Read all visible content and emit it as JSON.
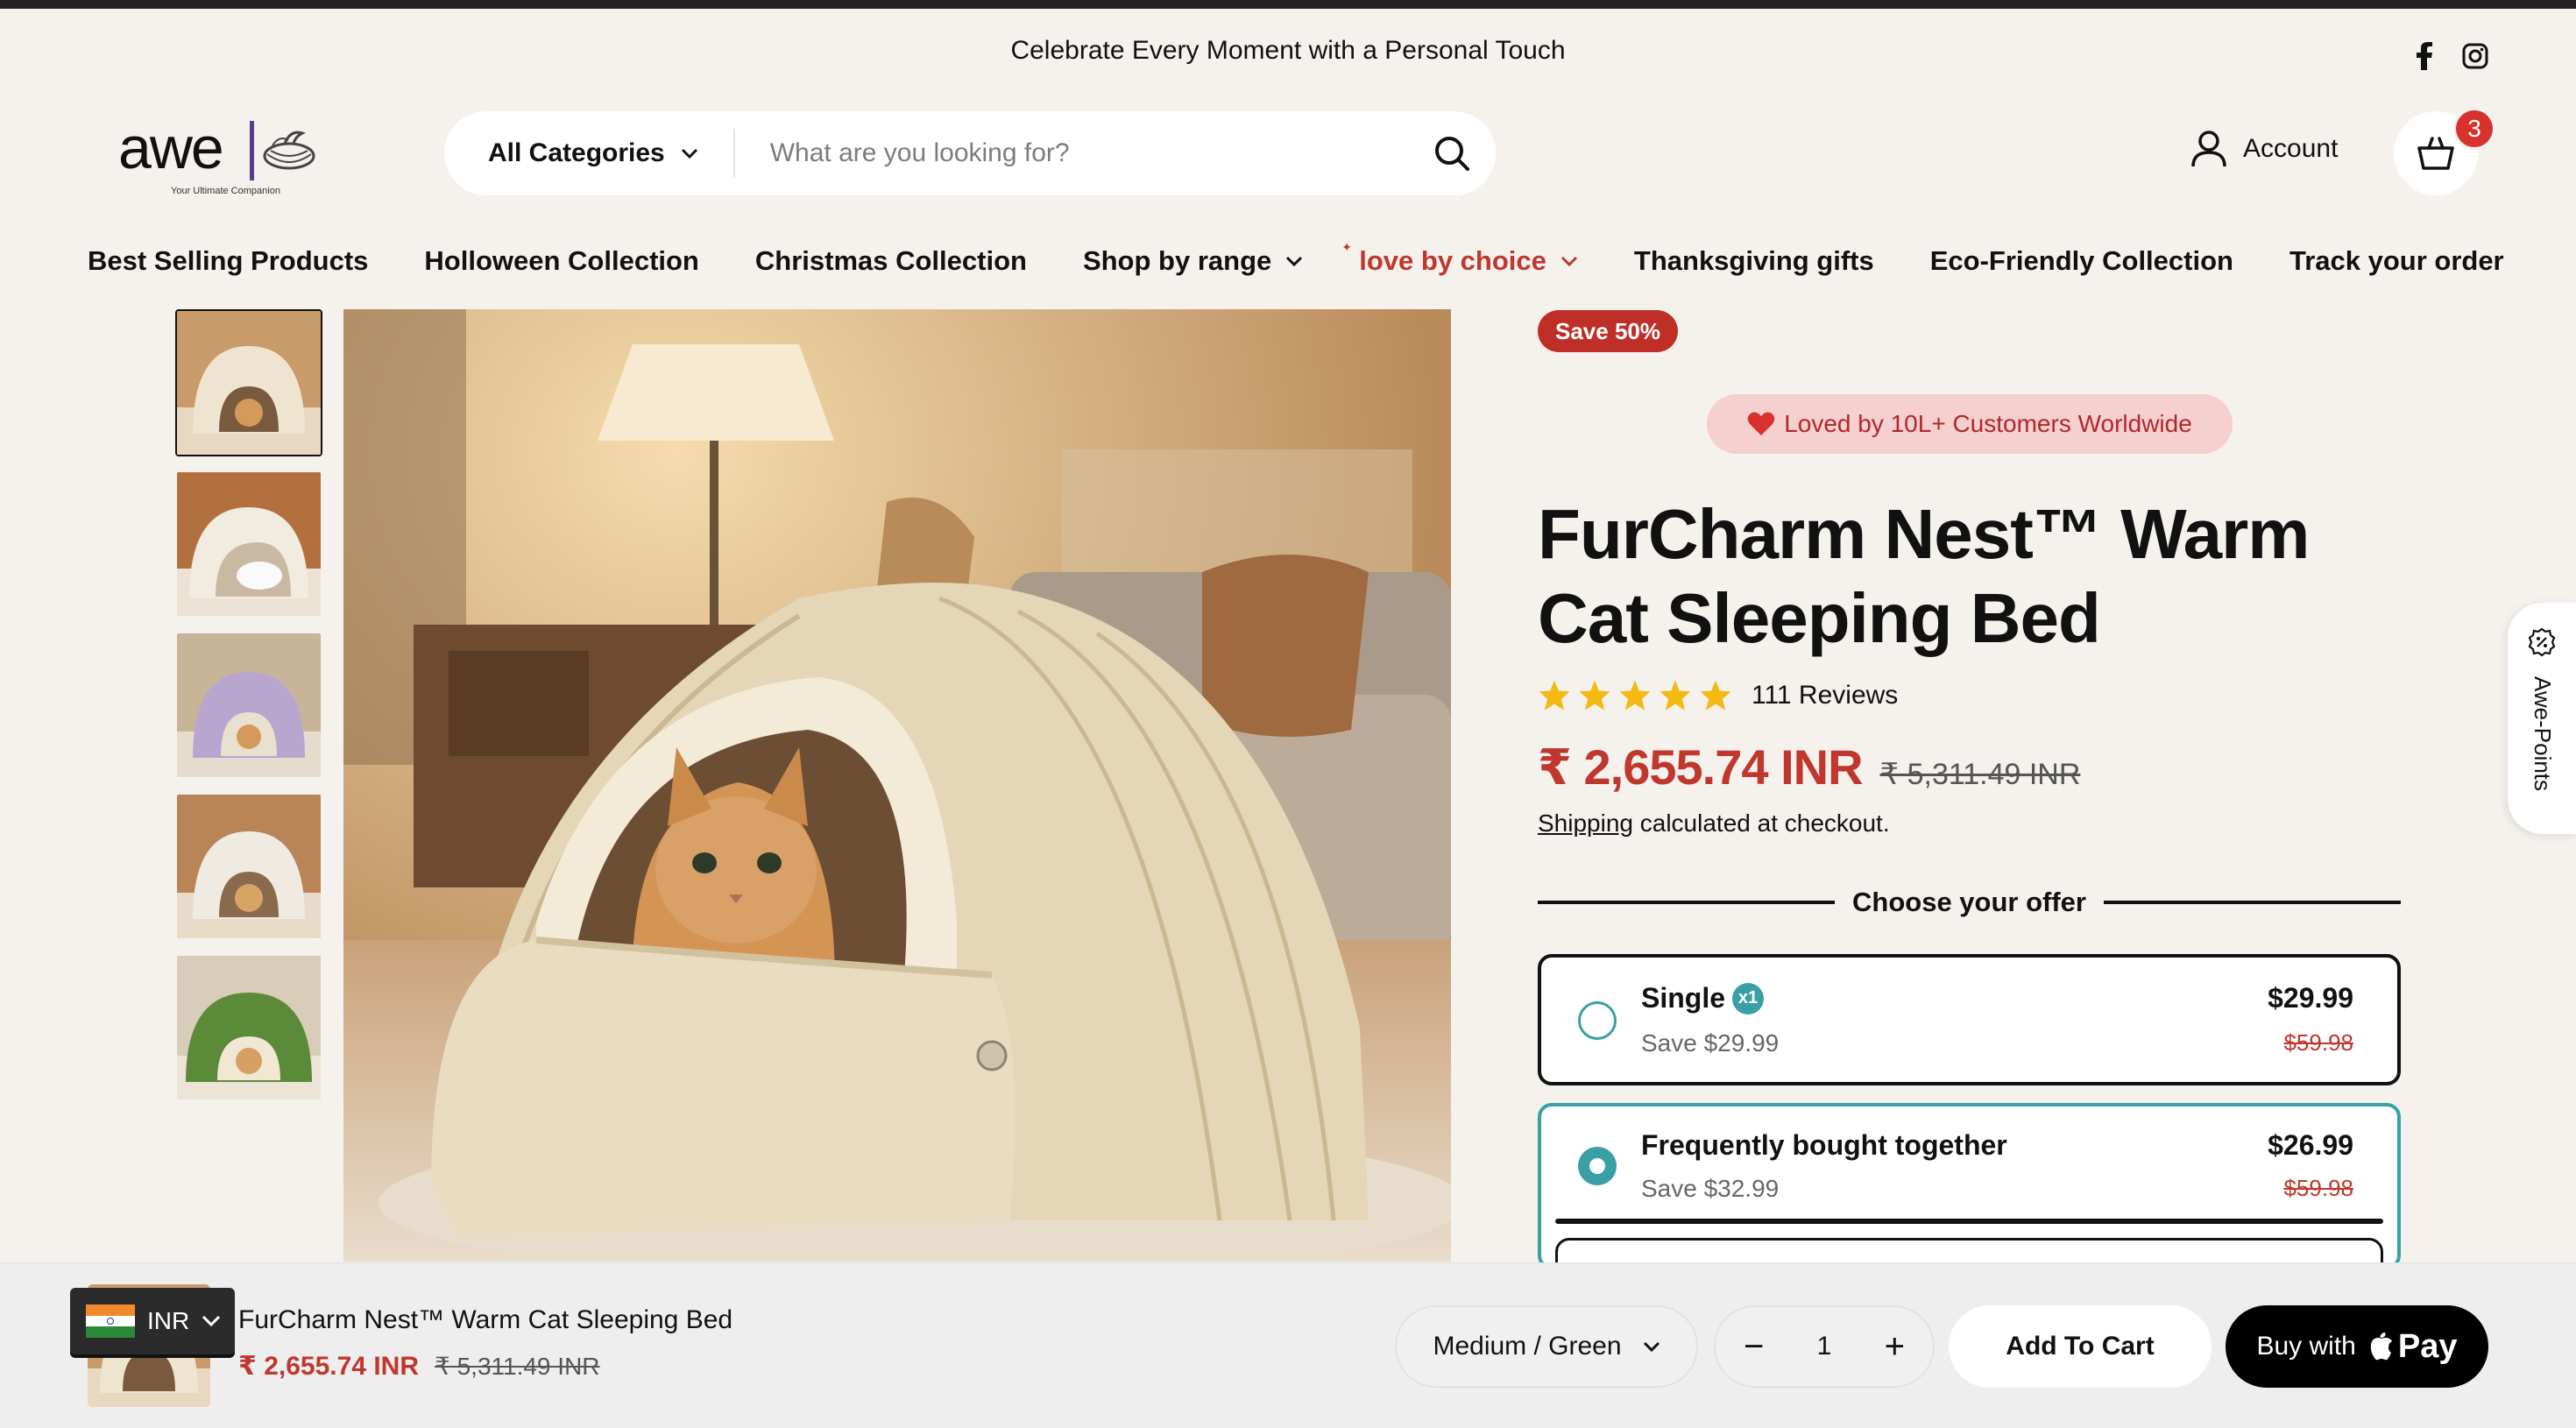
{
  "announcement": {
    "text": "Celebrate Every Moment with a Personal Touch"
  },
  "social": {
    "icons": [
      "facebook-icon",
      "instagram-icon"
    ]
  },
  "logo": {
    "wordmark": "awe",
    "tagline": "Your Ultimate Companion"
  },
  "search": {
    "category": "All Categories",
    "placeholder": "What are you looking for?"
  },
  "header": {
    "account_label": "Account",
    "cart_count": "3"
  },
  "nav": {
    "items": [
      {
        "label": "Best Selling Products"
      },
      {
        "label": "Holloween Collection"
      },
      {
        "label": "Christmas Collection"
      },
      {
        "label": "Shop by range"
      },
      {
        "label": "love by choice"
      },
      {
        "label": "Thanksgiving gifts"
      },
      {
        "label": "Eco-Friendly Collection"
      },
      {
        "label": "Track your order"
      }
    ]
  },
  "product": {
    "save_badge": "Save 50%",
    "loved_badge": "Loved by 10L+ Customers Worldwide",
    "title": "FurCharm Nest™ Warm Cat Sleeping Bed",
    "reviews": "111 Reviews",
    "rating": 5,
    "price": "₹ 2,655.74 INR",
    "compare_price": "₹ 5,311.49 INR",
    "shipping_link": "Shipping",
    "shipping_text": " calculated at checkout."
  },
  "offers": {
    "heading": "Choose your offer",
    "items": [
      {
        "name": "Single",
        "chip": "x1",
        "save": "Save $29.99",
        "price": "$29.99",
        "compare": "$59.98",
        "selected": false
      },
      {
        "name": "Frequently bought together",
        "save": "Save $32.99",
        "price": "$26.99",
        "compare": "$59.98",
        "selected": true
      }
    ]
  },
  "side_tab": {
    "label": "Awe-Points"
  },
  "sticky": {
    "currency": "INR",
    "title": "FurCharm Nest™ Warm Cat Sleeping Bed",
    "price": "₹ 2,655.74 INR",
    "compare_price": "₹ 5,311.49 INR",
    "variant": "Medium / Green",
    "quantity": "1",
    "add_to_cart": "Add To Cart",
    "buy_with": "Buy with",
    "pay_brand": "Pay"
  },
  "colors": {
    "accent_red": "#c0382d",
    "teal": "#3aa0a6",
    "background": "#f5f1ed"
  }
}
